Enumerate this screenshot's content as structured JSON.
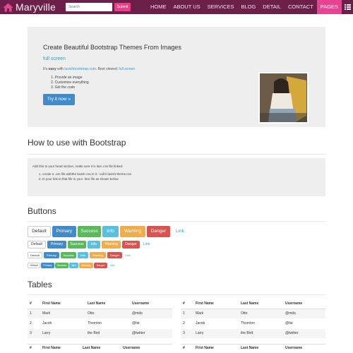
{
  "navbar": {
    "brand": "Maryville",
    "search_placeholder": "Search",
    "submit_label": "Submit",
    "items": [
      {
        "label": "HOME"
      },
      {
        "label": "ABOUT US"
      },
      {
        "label": "SERVICES"
      },
      {
        "label": "BLOG"
      },
      {
        "label": "DETAIL"
      },
      {
        "label": "CONTACT"
      },
      {
        "label": "PAGES"
      }
    ]
  },
  "jumbotron": {
    "title": "Create Beautiful Bootstrap Themes From Images",
    "link": "full screen",
    "line_prefix": "It's ",
    "line_easy": "easy",
    "line_mid": " with ",
    "line_site": "lavishbootstrap.com",
    "line_best": ". Best viewed: ",
    "line_full": "full screen",
    "steps": [
      "Provide an image",
      "Customize everything",
      "Get the code"
    ],
    "button": "Try it now »"
  },
  "howto": {
    "heading": "How to use with Bootstrap",
    "intro": "Add this to your head section, make sure it is last .css file linked.",
    "steps": [
      "create a .css file withthe lavish css in it - call it lavish-theme.css",
      "In your link to that file in your .htm file as shown below"
    ]
  },
  "buttons": {
    "heading": "Buttons",
    "labels": [
      "Default",
      "Primary",
      "Success",
      "Info",
      "Warning",
      "Danger",
      "Link"
    ]
  },
  "tables": {
    "heading": "Tables",
    "headers": [
      "#",
      "First Name",
      "Last Name",
      "Username"
    ],
    "rows": [
      [
        "1",
        "Mark",
        "Otto",
        "@mdo"
      ],
      [
        "2",
        "Jacob",
        "Thornton",
        "@fat"
      ],
      [
        "3",
        "Larry",
        "the Bird",
        "@twitter"
      ]
    ]
  },
  "colors": {
    "nav_bg": "#6c1f49",
    "nav_active": "#e84393",
    "link": "#2a9fd6"
  }
}
